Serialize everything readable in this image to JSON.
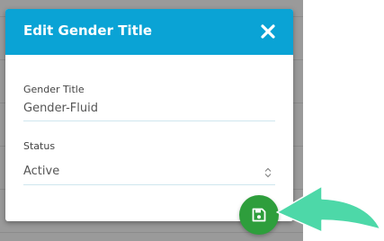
{
  "modal": {
    "title": "Edit Gender Title",
    "close_icon": "close-icon",
    "fields": {
      "gender_title": {
        "label": "Gender Title",
        "value": "Gender-Fluid"
      },
      "status": {
        "label": "Status",
        "value": "Active"
      }
    },
    "save_icon": "floppy-disk-icon"
  },
  "colors": {
    "header": "#0aa3d5",
    "save_button": "#2e9e3c",
    "pointer_arrow": "#4dd8a8"
  }
}
